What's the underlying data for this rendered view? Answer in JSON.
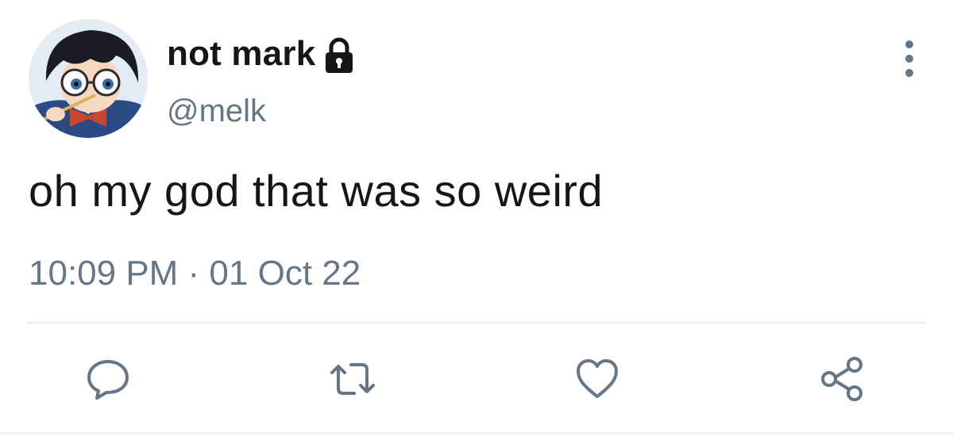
{
  "tweet": {
    "display_name": "not mark",
    "handle": "@melk",
    "text": "oh my god that was so weird",
    "timestamp": "10:09 PM · 01 Oct 22",
    "protected": true
  },
  "icons": {
    "avatar": "anime-character-avatar",
    "lock": "lock-icon",
    "more": "more-vertical-icon",
    "reply": "reply-icon",
    "retweet": "retweet-icon",
    "like": "heart-icon",
    "share": "share-icon"
  },
  "colors": {
    "text": "#14171a",
    "secondary": "#657786",
    "icon": "#657786",
    "divider": "#e6ecf0"
  }
}
